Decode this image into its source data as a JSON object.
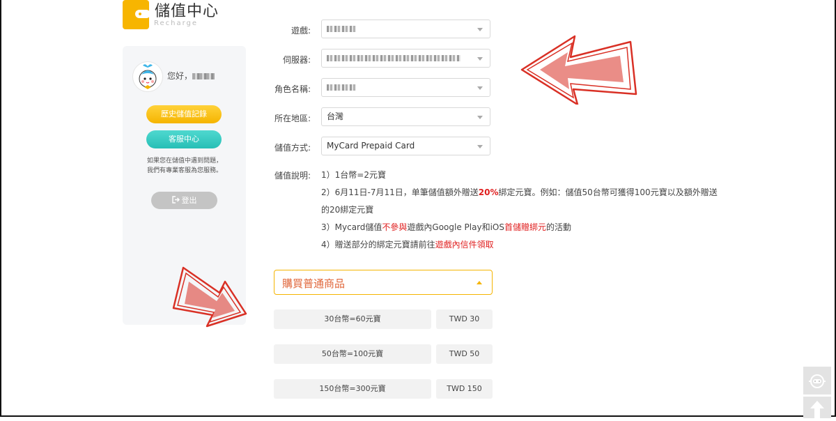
{
  "header": {
    "title": "儲值中心",
    "subtitle": "Recharge"
  },
  "sidebar": {
    "greeting": "您好，",
    "history_button": "歷史儲值記錄",
    "service_button": "客服中心",
    "help_line1": "如果您在儲值中遇到問題，",
    "help_line2": "我們有專業客服為您服務。",
    "logout_button": "登出"
  },
  "form": {
    "game_label": "遊戲:",
    "server_label": "伺服器:",
    "character_label": "角色名稱:",
    "region_label": "所在地區:",
    "region_value": "台灣",
    "method_label": "儲值方式:",
    "method_value": "MyCard Prepaid Card"
  },
  "description": {
    "label": "儲值說明:",
    "line1": "1）1台幣=2元寶",
    "line2_a": "2）6月11日-7月11日，单筆儲值額外贈送",
    "line2_b": "20%",
    "line2_c": "綁定元寶。例如：儲值50台幣可獲得100元寶以及額外贈送",
    "line2_d": "的20綁定元寶",
    "line3_a": "3）Mycard儲值",
    "line3_b": "不參與",
    "line3_c": "遊戲內Google Play和iOS",
    "line3_d": "首儲贈綁元",
    "line3_e": "的活動",
    "line4_a": "4）贈送部分的綁定元寶請前往",
    "line4_b": "遊戲內信件領取"
  },
  "purchase": {
    "section_label": "購買普通商品",
    "items": [
      {
        "name": "30台幣=60元寶",
        "price": "TWD 30"
      },
      {
        "name": "50台幣=100元寶",
        "price": "TWD 50"
      },
      {
        "name": "150台幣=300元寶",
        "price": "TWD 150"
      }
    ]
  },
  "colors": {
    "accent_yellow": "#f5b400",
    "accent_teal": "#27bfb6",
    "highlight_red": "#e02020",
    "annotation_arrow_red": "#d93025"
  },
  "icons": {
    "logo": "wallet-icon",
    "logout": "logout-icon",
    "chat": "chat-robot-icon",
    "back_to_top": "arrow-up-icon"
  }
}
